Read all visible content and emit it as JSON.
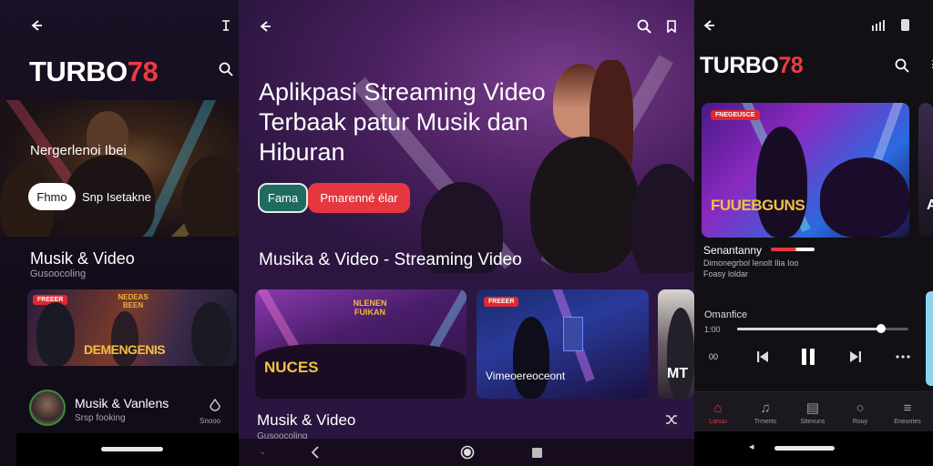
{
  "colors": {
    "brand_red": "#e6373f",
    "left_bg": "#140d1c",
    "mid_bg": "#2c1640",
    "right_bg": "#121014",
    "accent_teal": "#1f6b5f",
    "light_blue": "#8fd2ee"
  },
  "left": {
    "logo_text": "TURBO",
    "logo_num": "78",
    "hero_title": "Nergerlenoi Ibei",
    "primary_button": "Fhmo",
    "secondary_button": "Snp Isetakne",
    "section_title": "Musik & Video",
    "section_subtitle": "Gusoocoling",
    "thumb_tag": "FREEER",
    "thumb_title": "DEMENGENIS",
    "thumb_sign": "NEDEAS BEEN",
    "artist_name": "Musik & Vanlens",
    "artist_sub": "Srsp fooking",
    "artist_meta": "Snooo",
    "icons": [
      "back-icon",
      "share-icon",
      "search-icon",
      "drop-icon"
    ]
  },
  "mid": {
    "headline": "Aplikpasi Streaming Video Terbaak patur Musik dan Hiburan",
    "button_primary": "Fama",
    "button_secondary": "Pmarenné élar",
    "section_title": "Musika & Video - Streaming Video",
    "card1_title": "NUCES",
    "card1_sign": "NLENEN FUIKAN",
    "card2_tag": "FREEER",
    "card2_title": "Vimeoereoceont",
    "card3_title": "MT",
    "bottom_title": "Musik & Video",
    "bottom_sub": "Gusoocoling",
    "icons": [
      "back-icon",
      "search-icon",
      "bookmark-icon",
      "shuffle-icon"
    ]
  },
  "right": {
    "logo_text": "TURBO",
    "logo_num": "78",
    "card_tag": "FNEGEUSCE",
    "card_title": "FUUEBGUNS",
    "card_partial": "A",
    "track_title": "Senantanny",
    "track_line1": "Dimonegrbol Ienolt Ilia Ioo",
    "track_line2": "Foasy loldar",
    "player_label": "Omanfice",
    "time_current": "1:00",
    "time_counter": "00",
    "progress": 0.84,
    "tabs": [
      {
        "label": "Lanuu",
        "icon": "home-icon"
      },
      {
        "label": "Trmerto",
        "icon": "music-icon"
      },
      {
        "label": "Sitevuns",
        "icon": "library-icon"
      },
      {
        "label": "Rouy",
        "icon": "circle-icon"
      },
      {
        "label": "Eneuntes",
        "icon": "menu-icon"
      }
    ]
  },
  "system_icons": [
    "signal-icon",
    "battery-icon"
  ]
}
